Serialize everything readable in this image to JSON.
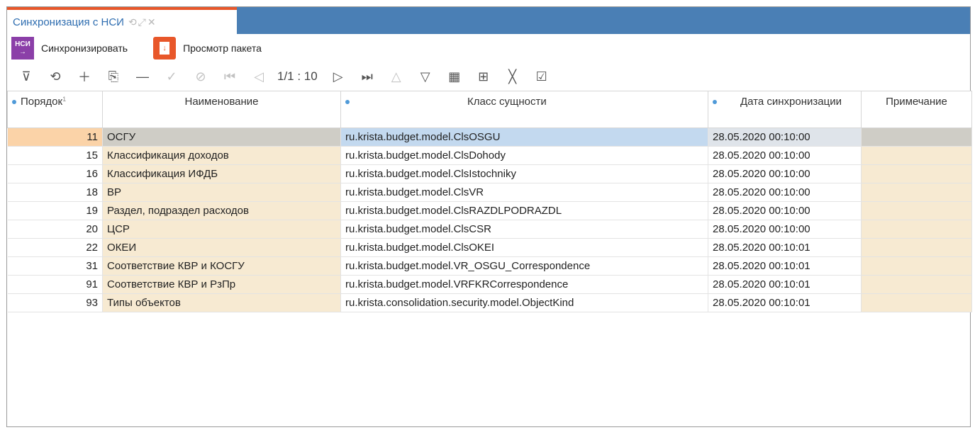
{
  "tab": {
    "title": "Синхронизация с НСИ"
  },
  "actions": {
    "sync_icon_text": "НСИ",
    "sync_label": "Синхронизировать",
    "view_label": "Просмотр пакета"
  },
  "toolbar": {
    "pager": "1/1 : 10",
    "icons": [
      "filter-icon",
      "refresh-icon",
      "add-icon",
      "copy-icon",
      "remove-icon",
      "check-icon",
      "cancel-icon",
      "first-page-icon",
      "prev-page-icon",
      "next-page-icon",
      "last-page-icon",
      "move-up-icon",
      "move-down-icon",
      "grid-view-icon",
      "add-column-icon",
      "clear-icon",
      "export-icon"
    ]
  },
  "grid": {
    "headers": {
      "order": "Порядок",
      "sort_indicator": "1",
      "name": "Наименование",
      "class": "Класс сущности",
      "date": "Дата синхронизации",
      "note": "Примечание"
    },
    "rows": [
      {
        "order": "11",
        "name": "ОСГУ",
        "class": "ru.krista.budget.model.ClsOSGU",
        "date": "28.05.2020 00:10:00",
        "note": ""
      },
      {
        "order": "15",
        "name": "Классификация доходов",
        "class": "ru.krista.budget.model.ClsDohody",
        "date": "28.05.2020 00:10:00",
        "note": ""
      },
      {
        "order": "16",
        "name": "Классификация ИФДБ",
        "class": "ru.krista.budget.model.ClsIstochniky",
        "date": "28.05.2020 00:10:00",
        "note": ""
      },
      {
        "order": "18",
        "name": "ВР",
        "class": "ru.krista.budget.model.ClsVR",
        "date": "28.05.2020 00:10:00",
        "note": ""
      },
      {
        "order": "19",
        "name": "Раздел, подраздел расходов",
        "class": "ru.krista.budget.model.ClsRAZDLPODRAZDL",
        "date": "28.05.2020 00:10:00",
        "note": ""
      },
      {
        "order": "20",
        "name": "ЦСР",
        "class": "ru.krista.budget.model.ClsCSR",
        "date": "28.05.2020 00:10:00",
        "note": ""
      },
      {
        "order": "22",
        "name": "ОКЕИ",
        "class": "ru.krista.budget.model.ClsOKEI",
        "date": "28.05.2020 00:10:01",
        "note": ""
      },
      {
        "order": "31",
        "name": "Соответствие КВР и КОСГУ",
        "class": "ru.krista.budget.model.VR_OSGU_Correspondence",
        "date": "28.05.2020 00:10:01",
        "note": ""
      },
      {
        "order": "91",
        "name": "Соответствие КВР и РзПр",
        "class": "ru.krista.budget.model.VRFKRCorrespondence",
        "date": "28.05.2020 00:10:01",
        "note": ""
      },
      {
        "order": "93",
        "name": "Типы объектов",
        "class": "ru.krista.consolidation.security.model.ObjectKind",
        "date": "28.05.2020 00:10:01",
        "note": ""
      }
    ]
  }
}
